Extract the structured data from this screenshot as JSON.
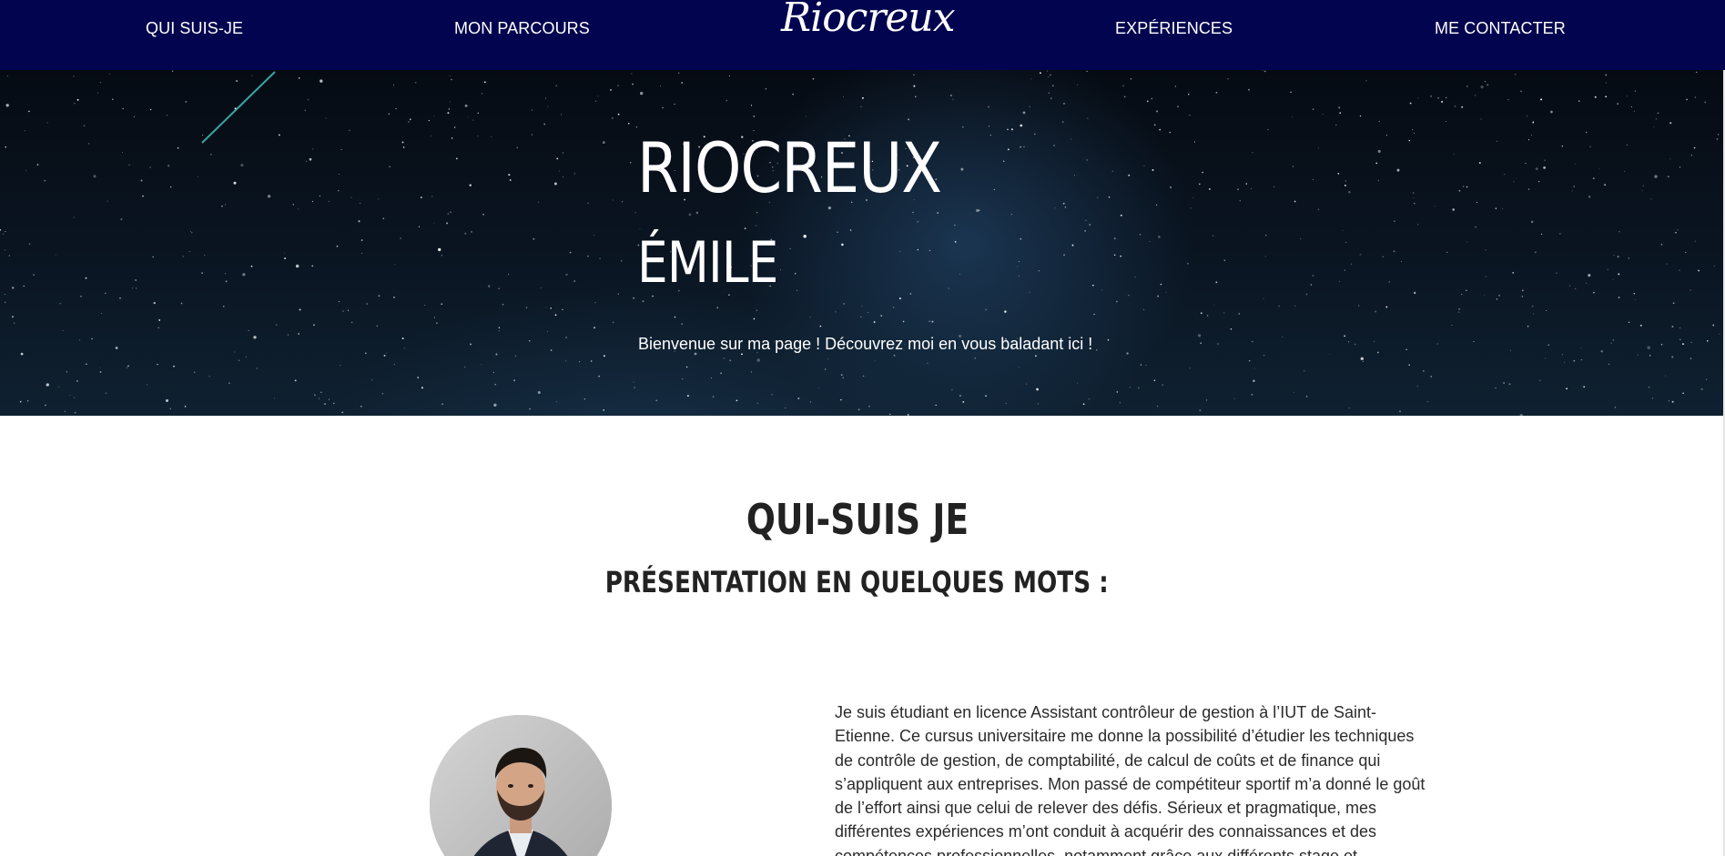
{
  "nav": {
    "items": [
      {
        "label": "QUI SUIS-JE"
      },
      {
        "label": "MON PARCOURS"
      },
      {
        "label": "EXPÉRIENCES"
      },
      {
        "label": "ME CONTACTER"
      }
    ],
    "logo": "Riocreux"
  },
  "hero": {
    "title": "RIOCREUX",
    "subtitle": "ÉMILE",
    "tagline": "Bienvenue sur ma page ! Découvrez moi en vous baladant ici !"
  },
  "about": {
    "title": "QUI-SUIS JE",
    "subtitle": "PRÉSENTATION EN QUELQUES MOTS :",
    "bio": "Je suis étudiant en licence Assistant contrôleur de gestion à l’IUT de Saint-Etienne. Ce cursus universitaire me donne la possibilité d’étudier les techniques de contrôle de gestion, de comptabilité, de calcul de coûts et de finance qui s’appliquent aux entreprises. Mon passé de compétiteur sportif m’a donné le goût de l’effort ainsi que celui de relever des défis. Sérieux et pragmatique, mes différentes expériences m’ont conduit à acquérir des connaissances et des compétences professionnelles, notamment grâce aux différents stage et l’alternance."
  },
  "colors": {
    "navbar_bg": "#02044f",
    "text_light": "#ffffff",
    "heading_dark": "#222222"
  }
}
